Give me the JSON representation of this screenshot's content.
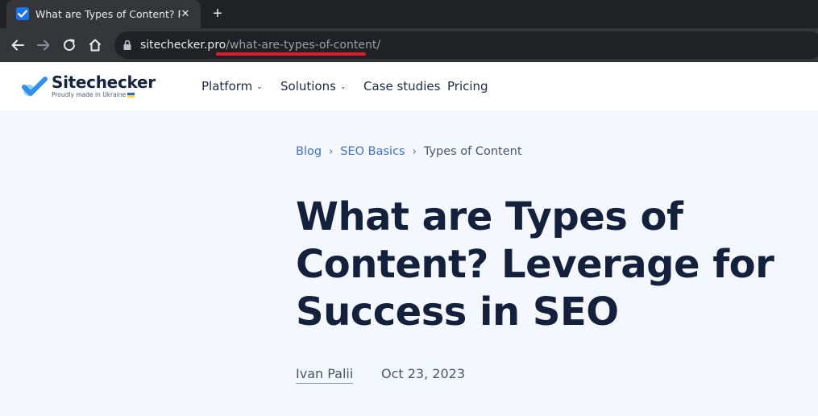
{
  "browser": {
    "tab_title": "What are Types of Content? Popular Types",
    "url_domain": "sitechecker.pro",
    "url_path": "/what-are-types-of-content/",
    "accent_underline_color": "#e41e1e"
  },
  "site": {
    "logo_name": "Sitechecker",
    "logo_tagline": "Proudly made in Ukraine",
    "nav": [
      {
        "label": "Platform",
        "has_dropdown": true
      },
      {
        "label": "Solutions",
        "has_dropdown": true
      },
      {
        "label": "Case studies",
        "has_dropdown": false
      },
      {
        "label": "Pricing",
        "has_dropdown": false
      }
    ]
  },
  "breadcrumb": {
    "items": [
      "Blog",
      "SEO Basics",
      "Types of Content"
    ],
    "separator": "›"
  },
  "article": {
    "title_lines": [
      "What are Types of",
      "Content? Leverage for",
      "Success in SEO"
    ],
    "author": "Ivan Palii",
    "date": "Oct 23, 2023"
  },
  "icons": [
    "favicon-icon",
    "close-icon",
    "plus-icon",
    "back-icon",
    "forward-icon",
    "reload-icon",
    "home-icon",
    "lock-icon",
    "logo-check-icon",
    "chevron-down-icon"
  ]
}
